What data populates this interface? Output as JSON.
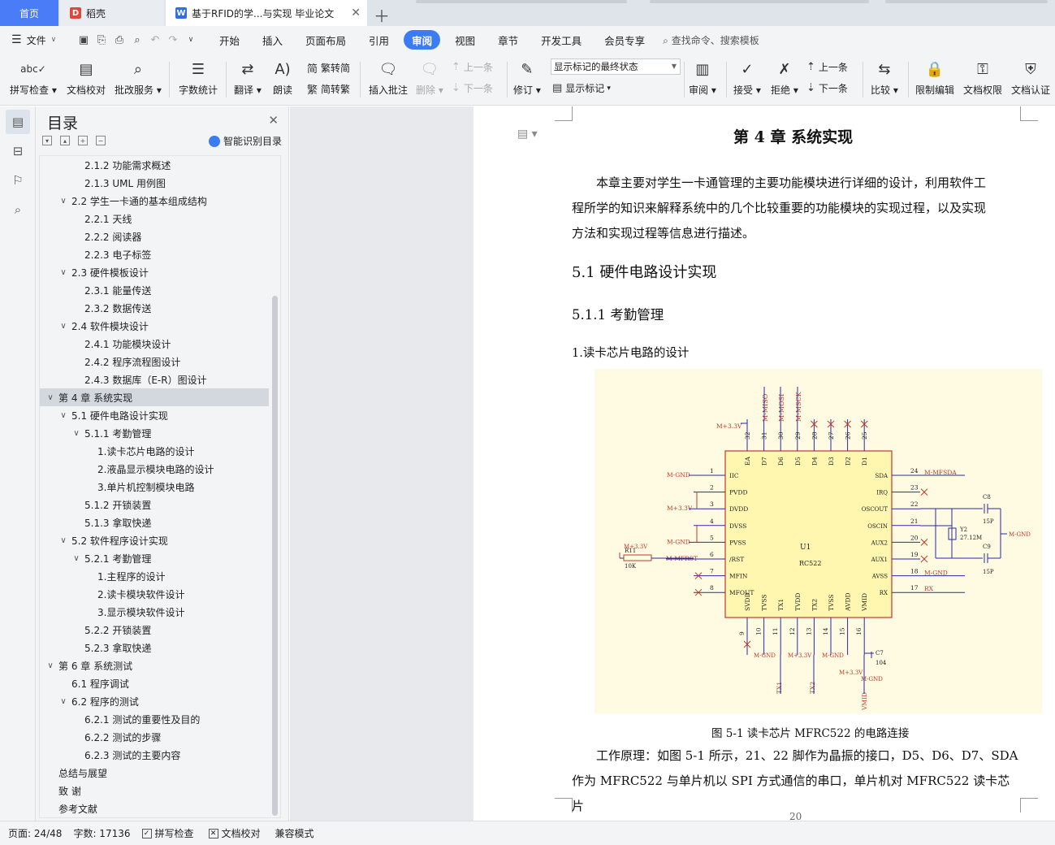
{
  "tabs": {
    "home": "首页",
    "daoke": "稻壳",
    "doc": "基于RFID的学...与实现 毕业论文"
  },
  "menu": {
    "file": "文件",
    "items": [
      "开始",
      "插入",
      "页面布局",
      "引用",
      "审阅",
      "视图",
      "章节",
      "开发工具",
      "会员专享"
    ],
    "active": "审阅",
    "search": "查找命令、搜索模板"
  },
  "ribbon": {
    "spell": "拼写检查",
    "doc_check": "文档校对",
    "review_service": "批改服务",
    "word_count": "字数统计",
    "translate": "翻译",
    "read_aloud": "朗读",
    "to_trad": "繁转简",
    "to_simp": "简转繁",
    "insert_comment": "插入批注",
    "delete": "删除",
    "prev_comment": "上一条",
    "next_comment": "下一条",
    "track": "修订",
    "markup_state": "显示标记的最终状态",
    "show_markup": "显示标记",
    "review_pane": "审阅",
    "accept": "接受",
    "reject": "拒绝",
    "prev_change": "上一条",
    "next_change": "下一条",
    "compare": "比较",
    "restrict": "限制编辑",
    "permission": "文档权限",
    "certify": "文档认证"
  },
  "toc": {
    "title": "目录",
    "smart": "智能识别目录",
    "items": [
      {
        "level": 3,
        "text": "2.1.2 功能需求概述"
      },
      {
        "level": 3,
        "text": "2.1.3 UML 用例图"
      },
      {
        "level": 2,
        "text": "2.2 学生一卡通的基本组成结构",
        "expanded": true
      },
      {
        "level": 3,
        "text": "2.2.1 天线"
      },
      {
        "level": 3,
        "text": "2.2.2 阅读器"
      },
      {
        "level": 3,
        "text": "2.2.3 电子标签"
      },
      {
        "level": 2,
        "text": "2.3 硬件模板设计",
        "expanded": true
      },
      {
        "level": 3,
        "text": "2.3.1 能量传送"
      },
      {
        "level": 3,
        "text": "2.3.2 数据传送"
      },
      {
        "level": 2,
        "text": "2.4 软件模块设计",
        "expanded": true
      },
      {
        "level": 3,
        "text": "2.4.1 功能模块设计"
      },
      {
        "level": 3,
        "text": "2.4.2 程序流程图设计"
      },
      {
        "level": 3,
        "text": "2.4.3 数据库（E-R）图设计"
      },
      {
        "level": 1,
        "text": "第 4 章  系统实现",
        "expanded": true,
        "selected": true
      },
      {
        "level": 2,
        "text": "5.1 硬件电路设计实现",
        "expanded": true
      },
      {
        "level": 3,
        "text": "5.1.1 考勤管理",
        "expanded": true
      },
      {
        "level": 4,
        "text": "1.读卡芯片电路的设计"
      },
      {
        "level": 4,
        "text": "2.液晶显示模块电路的设计"
      },
      {
        "level": 4,
        "text": "3.单片机控制模块电路"
      },
      {
        "level": 3,
        "text": "5.1.2 开锁装置"
      },
      {
        "level": 3,
        "text": "5.1.3 拿取快递"
      },
      {
        "level": 2,
        "text": "5.2 软件程序设计实现",
        "expanded": true
      },
      {
        "level": 3,
        "text": "5.2.1 考勤管理",
        "expanded": true
      },
      {
        "level": 4,
        "text": "1.主程序的设计"
      },
      {
        "level": 4,
        "text": "2.读卡模块软件设计"
      },
      {
        "level": 4,
        "text": "3.显示模块软件设计"
      },
      {
        "level": 3,
        "text": "5.2.2 开锁装置"
      },
      {
        "level": 3,
        "text": "5.2.3 拿取快递"
      },
      {
        "level": 1,
        "text": "第 6 章  系统测试",
        "expanded": true
      },
      {
        "level": 2,
        "text": "6.1 程序调试"
      },
      {
        "level": 2,
        "text": "6.2 程序的测试",
        "expanded": true
      },
      {
        "level": 3,
        "text": "6.2.1  测试的重要性及目的"
      },
      {
        "level": 3,
        "text": "6.2.2  测试的步骤"
      },
      {
        "level": 3,
        "text": "6.2.3  测试的主要内容"
      },
      {
        "level": 1,
        "text": "总结与展望"
      },
      {
        "level": 1,
        "text": "致    谢"
      },
      {
        "level": 1,
        "text": "参考文献"
      }
    ]
  },
  "doc": {
    "chapter": "第 4 章  系统实现",
    "intro_lines": [
      "本章主要对学生一卡通管理的主要功能模块进行详细的设计，利用软件工",
      "程所学的知识来解释系统中的几个比较重要的功能模块的实现过程，以及实现",
      "方法和实现过程等信息进行描述。"
    ],
    "h2": "5.1 硬件电路设计实现",
    "h3": "5.1.1 考勤管理",
    "h4": "1.读卡芯片电路的设计",
    "caption": "图 5-1 读卡芯片 MFRC522 的电路连接",
    "body_lines": [
      "工作原理：如图 5-1 所示，21、22 脚作为晶振的接口，D5、D6、D7、SDA",
      "作为 MFRC522 与单片机以 SPI 方式通信的串口，单片机对 MFRC522 读卡芯片"
    ],
    "page_number": "20"
  },
  "schematic": {
    "chip_name": "U1",
    "chip_model": "RC522",
    "top_pins": [
      {
        "num": "32",
        "name": "EA"
      },
      {
        "num": "31",
        "name": "D7"
      },
      {
        "num": "30",
        "name": "D6"
      },
      {
        "num": "29",
        "name": "D5"
      },
      {
        "num": "28",
        "name": "D4"
      },
      {
        "num": "27",
        "name": "D3"
      },
      {
        "num": "26",
        "name": "D2"
      },
      {
        "num": "25",
        "name": "D1"
      }
    ],
    "top_nets": [
      "M+3.3V",
      "M-MISO",
      "M-MOSI",
      "M-MSCK"
    ],
    "left_pins": [
      {
        "num": "1",
        "name": "IIC",
        "net": "M-GND"
      },
      {
        "num": "2",
        "name": "PVDD",
        "net": ""
      },
      {
        "num": "3",
        "name": "DVDD",
        "net": "M+3.3V"
      },
      {
        "num": "4",
        "name": "DVSS",
        "net": ""
      },
      {
        "num": "5",
        "name": "PVSS",
        "net": "M-GND"
      },
      {
        "num": "6",
        "name": "/RST",
        "net": "M-MFRST"
      },
      {
        "num": "7",
        "name": "MFIN",
        "net": ""
      },
      {
        "num": "8",
        "name": "MFOUT",
        "net": ""
      }
    ],
    "right_pins": [
      {
        "num": "24",
        "name": "SDA",
        "net": "M-MFSDA"
      },
      {
        "num": "23",
        "name": "IRQ",
        "net": ""
      },
      {
        "num": "22",
        "name": "OSCOUT",
        "net": ""
      },
      {
        "num": "21",
        "name": "OSCIN",
        "net": ""
      },
      {
        "num": "20",
        "name": "AUX2",
        "net": ""
      },
      {
        "num": "19",
        "name": "AUX1",
        "net": ""
      },
      {
        "num": "18",
        "name": "AVSS",
        "net": "M-GND"
      },
      {
        "num": "17",
        "name": "RX",
        "net": "RX"
      }
    ],
    "bottom_pins": [
      {
        "num": "9",
        "name": "SVDD"
      },
      {
        "num": "10",
        "name": "TVSS"
      },
      {
        "num": "11",
        "name": "TX1"
      },
      {
        "num": "12",
        "name": "TVDD"
      },
      {
        "num": "13",
        "name": "TX2"
      },
      {
        "num": "14",
        "name": "TVSS"
      },
      {
        "num": "15",
        "name": "AVDD"
      },
      {
        "num": "16",
        "name": "VMID"
      }
    ],
    "bottom_nets": [
      "M-GND",
      "M+3.3V",
      "M-GND",
      "TX1",
      "TX2",
      "M+3.3V",
      "M-GND",
      "VMID"
    ],
    "resistor": {
      "ref": "R11",
      "value": "10K",
      "net": "M+3.3V"
    },
    "crystal": {
      "ref": "Y2",
      "value": "27.12M"
    },
    "caps": [
      {
        "ref": "C8",
        "value": "15P"
      },
      {
        "ref": "C9",
        "value": "15P"
      },
      {
        "ref": "C7",
        "value": "104"
      }
    ],
    "right_gnd": "M-GND"
  },
  "status": {
    "page": "页面: 24/48",
    "words": "字数: 17136",
    "spell": "拼写检查",
    "doc_check": "文档校对",
    "compat": "兼容模式"
  }
}
